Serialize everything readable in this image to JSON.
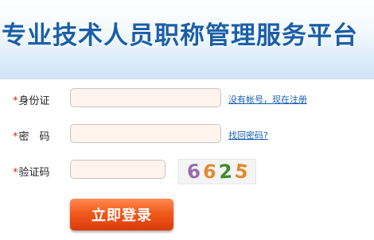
{
  "header": {
    "title": "专业技术人员职称管理服务平台"
  },
  "form": {
    "id_card": {
      "required_mark": "*",
      "label": "身份证",
      "value": "",
      "placeholder": ""
    },
    "password": {
      "required_mark": "*",
      "label": "密　码",
      "value": "",
      "placeholder": ""
    },
    "captcha": {
      "required_mark": "*",
      "label": "验证码",
      "value": "",
      "placeholder": "",
      "image_text": "6625"
    },
    "register_link": "没有帐号，现在注册",
    "forgot_link": "找回密码?",
    "login_button": "立即登录"
  },
  "colors": {
    "title": "#1b5fa8",
    "required": "#d6241c",
    "link": "#1a5fb0",
    "button": "#f15a1c",
    "field_bg": "#fff3ee"
  }
}
